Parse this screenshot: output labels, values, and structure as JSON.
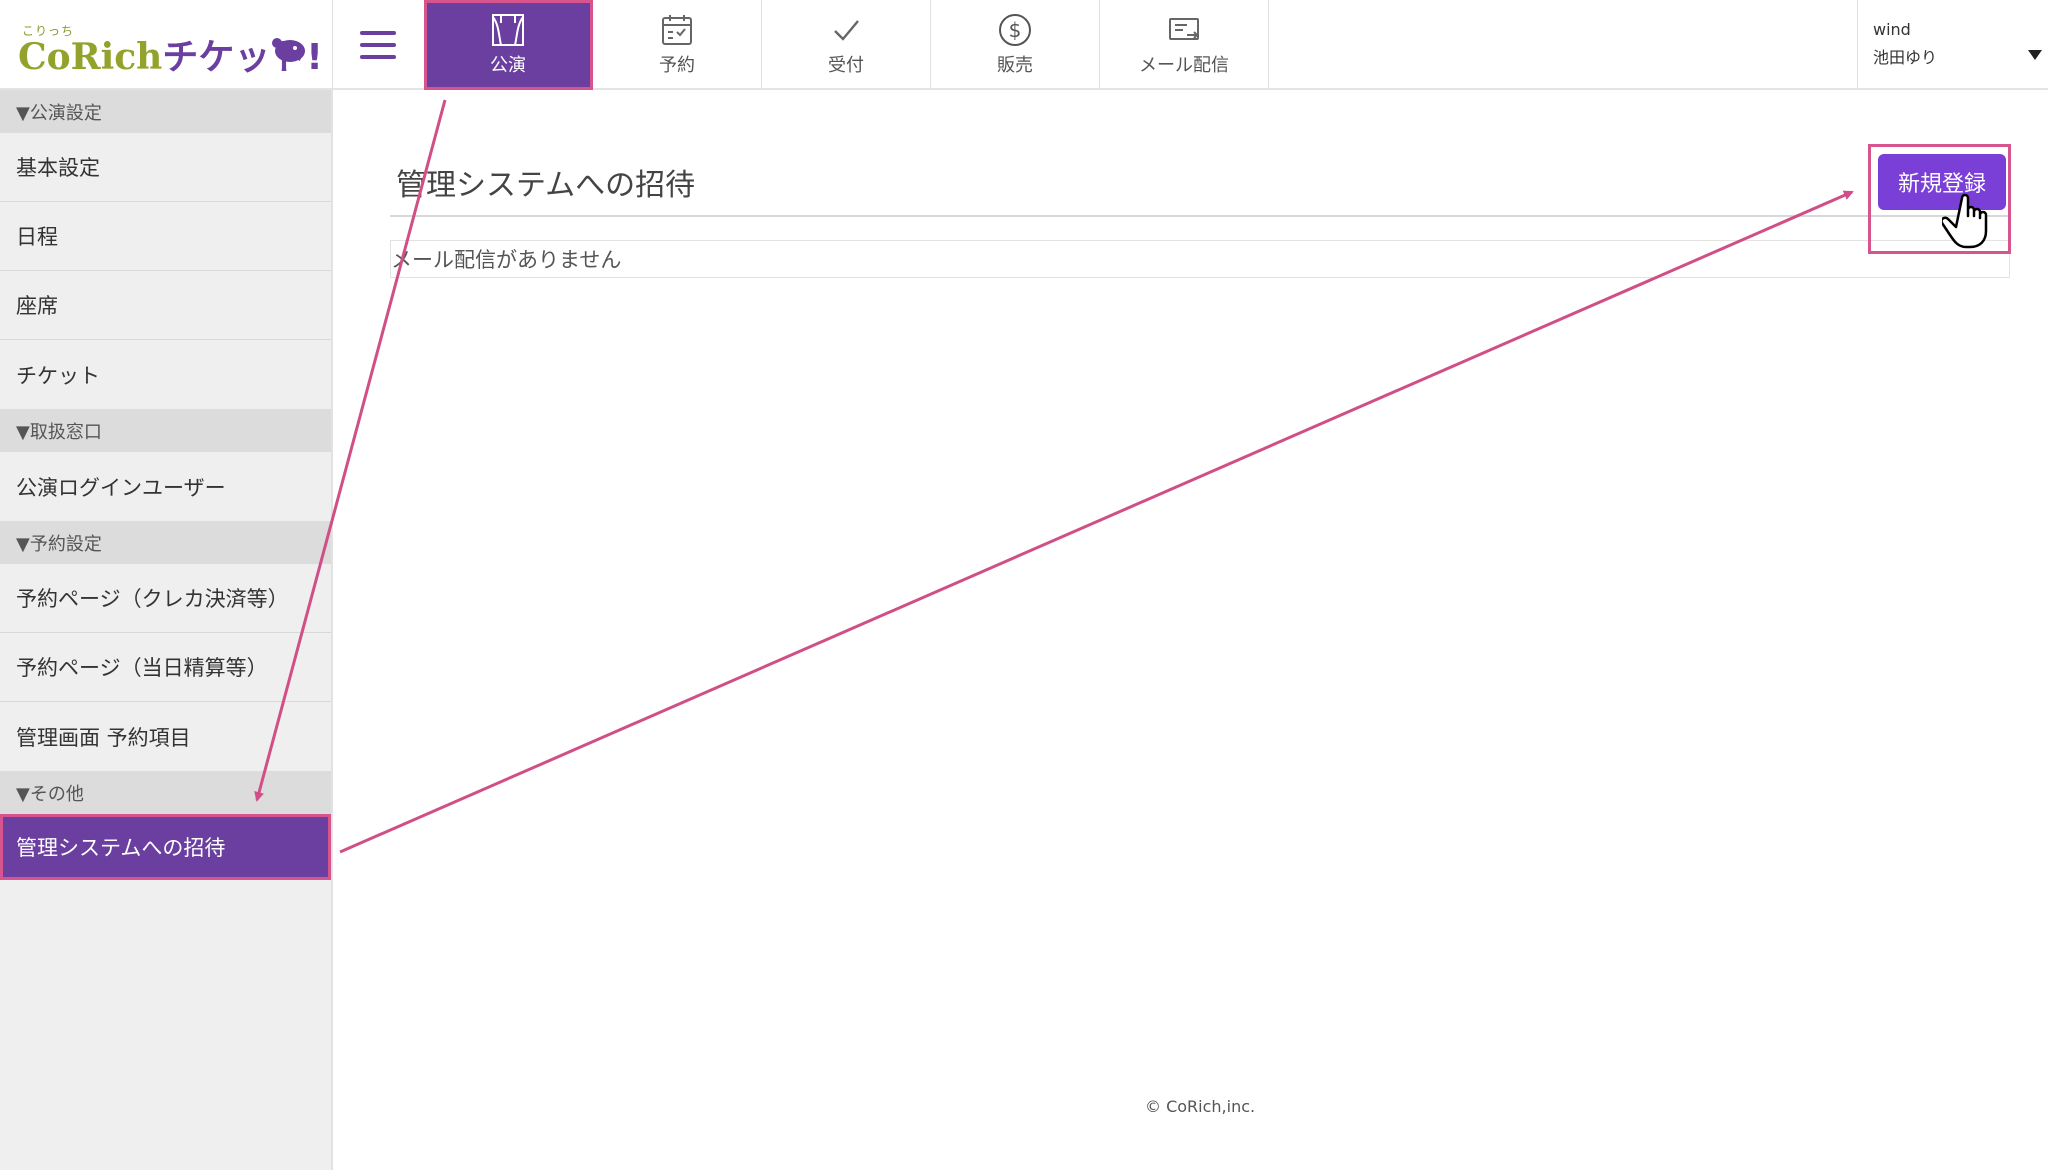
{
  "header": {
    "logo": {
      "small": "こりっち",
      "co": "CoRich",
      "ticket": "チケット!"
    },
    "tabs": [
      {
        "label": "公演",
        "icon": "curtain-stage-icon",
        "active": true
      },
      {
        "label": "予約",
        "icon": "calendar-check-icon",
        "active": false
      },
      {
        "label": "受付",
        "icon": "checkmark-icon",
        "active": false
      },
      {
        "label": "販売",
        "icon": "dollar-circle-icon",
        "active": false
      },
      {
        "label": "メール配信",
        "icon": "mail-send-icon",
        "active": false
      }
    ],
    "user": {
      "org": "wind",
      "name": "池田ゆり"
    }
  },
  "sidebar": {
    "sections": [
      {
        "title": "▼公演設定",
        "items": [
          "基本設定",
          "日程",
          "座席",
          "チケット"
        ]
      },
      {
        "title": "▼取扱窓口",
        "items": [
          "公演ログインユーザー"
        ]
      },
      {
        "title": "▼予約設定",
        "items": [
          "予約ページ（クレカ決済等）",
          "予約ページ（当日精算等）",
          "管理画面 予約項目"
        ]
      },
      {
        "title": "▼その他",
        "items": [
          "管理システムへの招待"
        ]
      }
    ],
    "active_item": "管理システムへの招待"
  },
  "main": {
    "title": "管理システムへの招待",
    "empty_message": "メール配信がありません",
    "new_button": "新規登録"
  },
  "footer": {
    "copyright": "© CoRich,inc."
  },
  "colors": {
    "brand_purple": "#6b3fa0",
    "button_purple": "#7a3fd6",
    "annotation_pink": "#d6558e",
    "logo_green": "#93a22b"
  }
}
